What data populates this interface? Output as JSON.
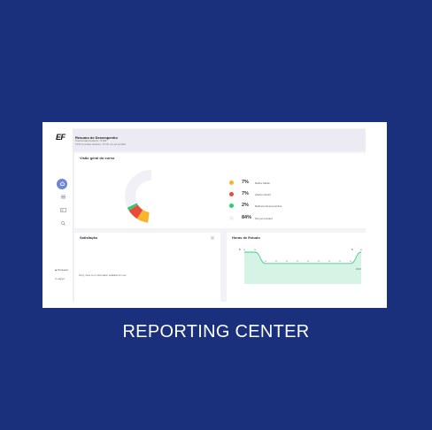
{
  "header": {
    "title": "Resumo de Desempenho",
    "line1": "Total enrolled students: 73.832",
    "line2": "70.874 enrolled students / 76.471 not yet enrolled"
  },
  "sidebar": {
    "items": [
      {
        "icon": "home-icon",
        "active": true
      },
      {
        "icon": "list-icon",
        "active": false
      },
      {
        "icon": "id-card-icon",
        "active": false
      },
      {
        "icon": "search-icon",
        "active": false
      }
    ],
    "footer_1": "Português",
    "footer_2": "Logout"
  },
  "overview": {
    "title": "Visão geral do curso",
    "legend": [
      {
        "pct": "7%",
        "label": "Melhor Médio",
        "color": "#f7b52c"
      },
      {
        "pct": "7%",
        "label": "Abaixo Inferior",
        "color": "#e84b3c"
      },
      {
        "pct": "2%",
        "label": "Melhores Desempenhos",
        "color": "#2ecc71"
      },
      {
        "pct": "84%",
        "label": "Not yet enrolled",
        "color": "#f1f0f7"
      }
    ]
  },
  "satisfaction": {
    "title": "Satisfação",
    "note": "Sorry, there is no information available for now"
  },
  "study_hours": {
    "title": "Horas de Estudo",
    "start_label": "5",
    "end_label": "5",
    "axis_end": "2016"
  },
  "caption": "REPORTING CENTER",
  "chart_data": [
    {
      "type": "pie",
      "title": "Visão geral do curso",
      "categories": [
        "Melhor Médio",
        "Abaixo Inferior",
        "Melhores Desempenhos",
        "Not yet enrolled"
      ],
      "values": [
        7,
        7,
        2,
        84
      ],
      "colors": [
        "#f7b52c",
        "#e84b3c",
        "#2ecc71",
        "#f1f0f7"
      ]
    },
    {
      "type": "area",
      "title": "Horas de Estudo",
      "x": [
        1,
        2,
        3,
        4,
        5,
        6,
        7,
        8,
        9,
        10,
        11,
        12
      ],
      "values": [
        5,
        5,
        1,
        1,
        1,
        1,
        1,
        1,
        1,
        1,
        1,
        5
      ],
      "color": "#3ecf8e",
      "grid": false
    }
  ]
}
